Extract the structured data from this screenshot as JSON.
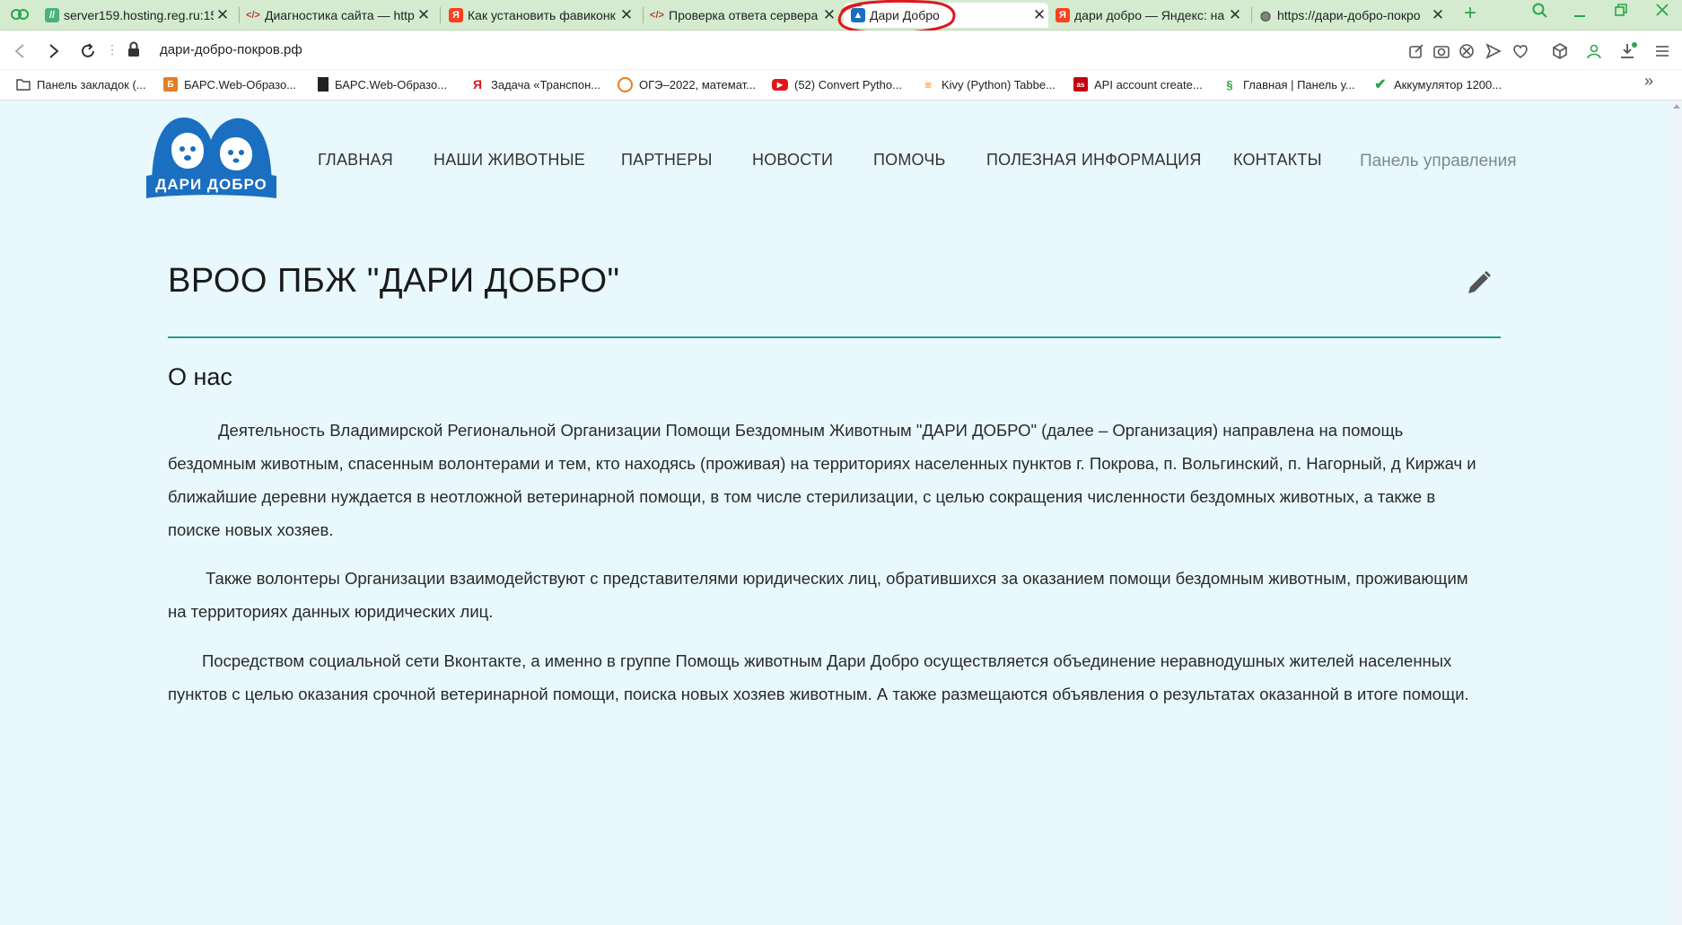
{
  "browser": {
    "tabs": [
      {
        "label": "server159.hosting.reg.ru:15",
        "icon": "reg-ru-icon"
      },
      {
        "label": "Диагностика сайта — http",
        "icon": "code-icon"
      },
      {
        "label": "Как установить фавиконк",
        "icon": "yandex-icon"
      },
      {
        "label": "Проверка ответа сервера",
        "icon": "code-icon"
      },
      {
        "label": "Дари Добро",
        "icon": "dari-dobro-icon",
        "active": true
      },
      {
        "label": "дари добро — Яндекс: на",
        "icon": "yandex-icon"
      },
      {
        "label": "https://дари-добро-покро",
        "icon": "globe-icon"
      }
    ],
    "new_tab": "+",
    "close_glyph": "✕",
    "url": "дари-добро-покров.рф",
    "bookmarks": [
      {
        "label": "Панель закладок (...",
        "icon": "folder-icon"
      },
      {
        "label": "БАРС.Web-Образо...",
        "icon": "bars-icon"
      },
      {
        "label": "БАРС.Web-Образо...",
        "icon": "file-icon"
      },
      {
        "label": "Задача «Транспон...",
        "icon": "yandex-icon"
      },
      {
        "label": "ОГЭ–2022, математ...",
        "icon": "oge-icon"
      },
      {
        "label": "(52) Convert Pytho...",
        "icon": "youtube-icon"
      },
      {
        "label": "Kivy (Python) Tabbe...",
        "icon": "stackoverflow-icon"
      },
      {
        "label": "API account create...",
        "icon": "lastfm-icon"
      },
      {
        "label": "Главная | Панель у...",
        "icon": "reg-icon"
      },
      {
        "label": "Аккумулятор 1200...",
        "icon": "checkmark-icon"
      }
    ],
    "bookmarks_more": "»",
    "accent": "#d4ebd0",
    "annotation_color": "#e0161d"
  },
  "site": {
    "logo_text": "ДАРИ ДОБРО",
    "nav": [
      {
        "label": "ГЛАВНАЯ"
      },
      {
        "label": "НАШИ ЖИВОТНЫЕ"
      },
      {
        "label": "ПАРТНЕРЫ"
      },
      {
        "label": "НОВОСТИ"
      },
      {
        "label": "ПОМОЧЬ"
      },
      {
        "label": "ПОЛЕЗНАЯ ИНФОРМАЦИЯ"
      },
      {
        "label": "КОНТАКТЫ"
      }
    ],
    "admin_link": "Панель управления",
    "title": "ВРОО ПБЖ \"ДАРИ ДОБРО\"",
    "subtitle": "О нас",
    "paragraphs": [
      "Деятельность Владимирской Региональной Организации Помощи Бездомным Животным \"ДАРИ ДОБРО\"  (далее – Организация) направлена на помощь бездомным животным, спасенным волонтерами и тем, кто находясь (проживая) на территориях населенных пунктов г. Покрова, п. Вольгинский, п. Нагорный, д Киржач и ближайшие деревни нуждается в неотложной ветеринарной помощи, в том числе стерилизации, с целью сокращения численности бездомных животных, а также в поиске новых хозяев.",
      "Также волонтеры Организации взаимодействуют с представителями юридических лиц, обратившихся за оказанием помощи бездомным животным, проживающим на территориях данных юридических лиц.",
      "Посредством социальной сети Вконтакте, а именно в группе Помощь животным Дари Добро осуществляется объединение неравнодушных жителей населенных пунктов с целью оказания срочной ветеринарной помощи, поиска новых хозяев животным. А также размещаются объявления о результатах оказанной в итоге помощи."
    ],
    "brand_color": "#1a6fc1",
    "rule_color": "#2a9d8f",
    "background": "#e8f8fd"
  }
}
